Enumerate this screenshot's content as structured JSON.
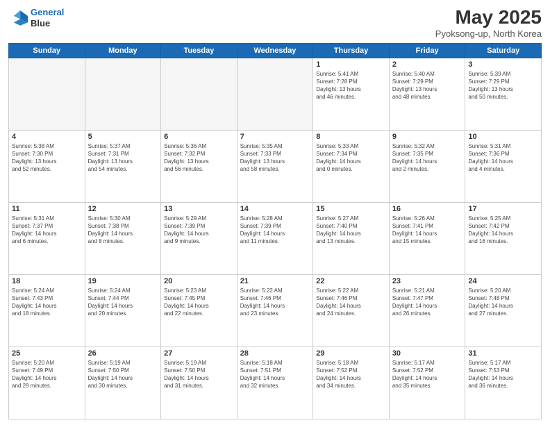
{
  "header": {
    "logo_line1": "General",
    "logo_line2": "Blue",
    "month": "May 2025",
    "location": "Pyoksong-up, North Korea"
  },
  "days_of_week": [
    "Sunday",
    "Monday",
    "Tuesday",
    "Wednesday",
    "Thursday",
    "Friday",
    "Saturday"
  ],
  "weeks": [
    [
      {
        "day": "",
        "info": ""
      },
      {
        "day": "",
        "info": ""
      },
      {
        "day": "",
        "info": ""
      },
      {
        "day": "",
        "info": ""
      },
      {
        "day": "1",
        "info": "Sunrise: 5:41 AM\nSunset: 7:28 PM\nDaylight: 13 hours\nand 46 minutes."
      },
      {
        "day": "2",
        "info": "Sunrise: 5:40 AM\nSunset: 7:29 PM\nDaylight: 13 hours\nand 48 minutes."
      },
      {
        "day": "3",
        "info": "Sunrise: 5:39 AM\nSunset: 7:29 PM\nDaylight: 13 hours\nand 50 minutes."
      }
    ],
    [
      {
        "day": "4",
        "info": "Sunrise: 5:38 AM\nSunset: 7:30 PM\nDaylight: 13 hours\nand 52 minutes."
      },
      {
        "day": "5",
        "info": "Sunrise: 5:37 AM\nSunset: 7:31 PM\nDaylight: 13 hours\nand 54 minutes."
      },
      {
        "day": "6",
        "info": "Sunrise: 5:36 AM\nSunset: 7:32 PM\nDaylight: 13 hours\nand 56 minutes."
      },
      {
        "day": "7",
        "info": "Sunrise: 5:35 AM\nSunset: 7:33 PM\nDaylight: 13 hours\nand 58 minutes."
      },
      {
        "day": "8",
        "info": "Sunrise: 5:33 AM\nSunset: 7:34 PM\nDaylight: 14 hours\nand 0 minutes."
      },
      {
        "day": "9",
        "info": "Sunrise: 5:32 AM\nSunset: 7:35 PM\nDaylight: 14 hours\nand 2 minutes."
      },
      {
        "day": "10",
        "info": "Sunrise: 5:31 AM\nSunset: 7:36 PM\nDaylight: 14 hours\nand 4 minutes."
      }
    ],
    [
      {
        "day": "11",
        "info": "Sunrise: 5:31 AM\nSunset: 7:37 PM\nDaylight: 14 hours\nand 6 minutes."
      },
      {
        "day": "12",
        "info": "Sunrise: 5:30 AM\nSunset: 7:38 PM\nDaylight: 14 hours\nand 8 minutes."
      },
      {
        "day": "13",
        "info": "Sunrise: 5:29 AM\nSunset: 7:39 PM\nDaylight: 14 hours\nand 9 minutes."
      },
      {
        "day": "14",
        "info": "Sunrise: 5:28 AM\nSunset: 7:39 PM\nDaylight: 14 hours\nand 11 minutes."
      },
      {
        "day": "15",
        "info": "Sunrise: 5:27 AM\nSunset: 7:40 PM\nDaylight: 14 hours\nand 13 minutes."
      },
      {
        "day": "16",
        "info": "Sunrise: 5:26 AM\nSunset: 7:41 PM\nDaylight: 14 hours\nand 15 minutes."
      },
      {
        "day": "17",
        "info": "Sunrise: 5:25 AM\nSunset: 7:42 PM\nDaylight: 14 hours\nand 16 minutes."
      }
    ],
    [
      {
        "day": "18",
        "info": "Sunrise: 5:24 AM\nSunset: 7:43 PM\nDaylight: 14 hours\nand 18 minutes."
      },
      {
        "day": "19",
        "info": "Sunrise: 5:24 AM\nSunset: 7:44 PM\nDaylight: 14 hours\nand 20 minutes."
      },
      {
        "day": "20",
        "info": "Sunrise: 5:23 AM\nSunset: 7:45 PM\nDaylight: 14 hours\nand 22 minutes."
      },
      {
        "day": "21",
        "info": "Sunrise: 5:22 AM\nSunset: 7:46 PM\nDaylight: 14 hours\nand 23 minutes."
      },
      {
        "day": "22",
        "info": "Sunrise: 5:22 AM\nSunset: 7:46 PM\nDaylight: 14 hours\nand 24 minutes."
      },
      {
        "day": "23",
        "info": "Sunrise: 5:21 AM\nSunset: 7:47 PM\nDaylight: 14 hours\nand 26 minutes."
      },
      {
        "day": "24",
        "info": "Sunrise: 5:20 AM\nSunset: 7:48 PM\nDaylight: 14 hours\nand 27 minutes."
      }
    ],
    [
      {
        "day": "25",
        "info": "Sunrise: 5:20 AM\nSunset: 7:49 PM\nDaylight: 14 hours\nand 29 minutes."
      },
      {
        "day": "26",
        "info": "Sunrise: 5:19 AM\nSunset: 7:50 PM\nDaylight: 14 hours\nand 30 minutes."
      },
      {
        "day": "27",
        "info": "Sunrise: 5:19 AM\nSunset: 7:50 PM\nDaylight: 14 hours\nand 31 minutes."
      },
      {
        "day": "28",
        "info": "Sunrise: 5:18 AM\nSunset: 7:51 PM\nDaylight: 14 hours\nand 32 minutes."
      },
      {
        "day": "29",
        "info": "Sunrise: 5:18 AM\nSunset: 7:52 PM\nDaylight: 14 hours\nand 34 minutes."
      },
      {
        "day": "30",
        "info": "Sunrise: 5:17 AM\nSunset: 7:52 PM\nDaylight: 14 hours\nand 35 minutes."
      },
      {
        "day": "31",
        "info": "Sunrise: 5:17 AM\nSunset: 7:53 PM\nDaylight: 14 hours\nand 36 minutes."
      }
    ]
  ]
}
